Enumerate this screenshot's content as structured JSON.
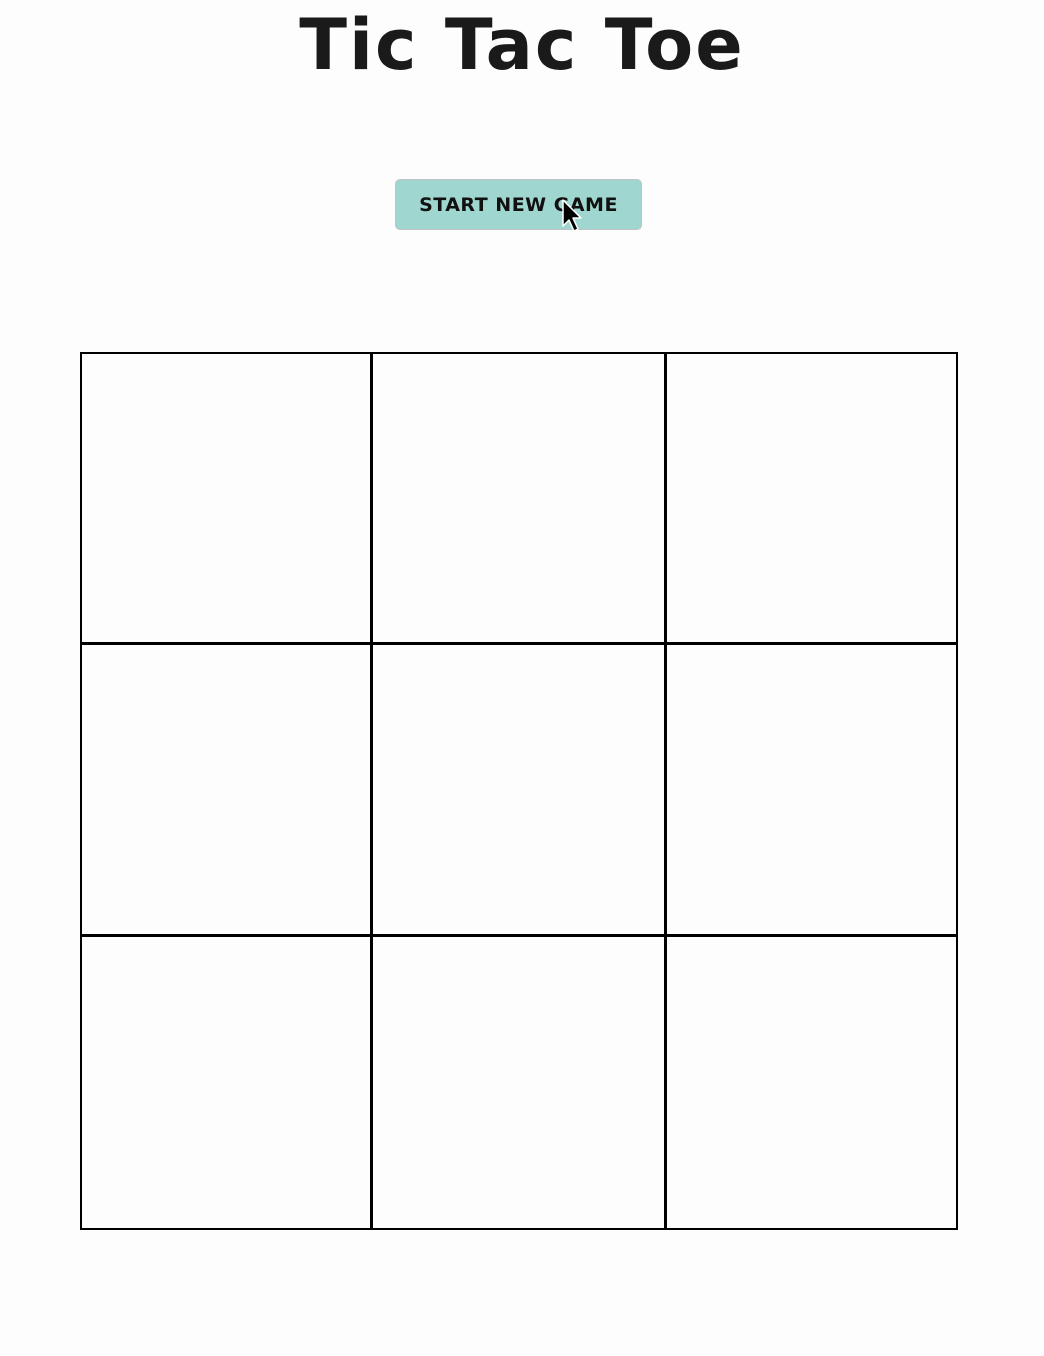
{
  "header": {
    "title": "Tic Tac Toe"
  },
  "controls": {
    "start_label": "START NEW GAME",
    "start_color": "#9fd6cf"
  },
  "board": {
    "cells": [
      "",
      "",
      "",
      "",
      "",
      "",
      "",
      "",
      ""
    ]
  }
}
